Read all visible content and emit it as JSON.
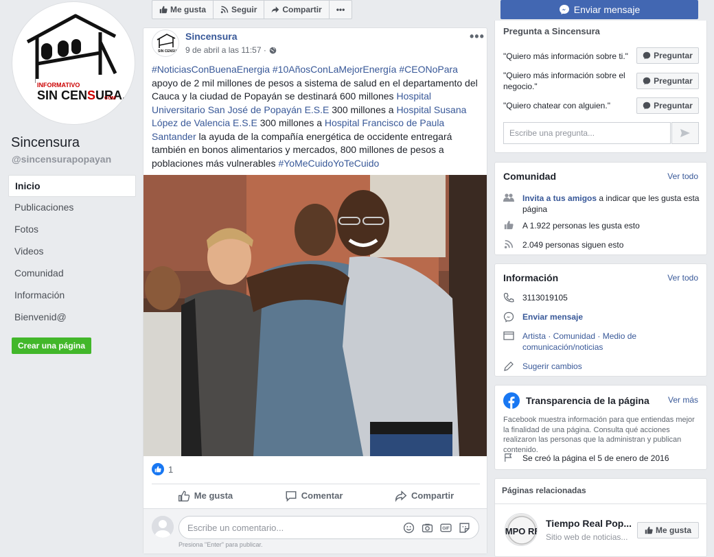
{
  "page": {
    "name": "Sincensura",
    "handle": "@sincensurapopayan",
    "logo_text": "INFORMATIVO SIN CENSURA.COM"
  },
  "nav": [
    {
      "label": "Inicio",
      "active": true
    },
    {
      "label": "Publicaciones"
    },
    {
      "label": "Fotos"
    },
    {
      "label": "Videos"
    },
    {
      "label": "Comunidad"
    },
    {
      "label": "Información"
    },
    {
      "label": "Bienvenid@"
    }
  ],
  "create_page": "Crear una página",
  "actionbar": {
    "like": "Me gusta",
    "follow": "Seguir",
    "share": "Compartir",
    "more": "•••"
  },
  "send_message": "Enviar mensaje",
  "post": {
    "author": "Sincensura",
    "date": "9 de abril a las 11:57 ·",
    "text": [
      {
        "t": "#NoticiasConBuenaEnergia #10AñosConLaMejorEnergía",
        "c": "tag"
      },
      {
        "t": " ",
        "c": ""
      },
      {
        "t": "#CEONoPara",
        "c": "tag"
      },
      {
        "t": " apoyo de 2 mil millones de pesos a sistema de salud en el departamento del Cauca y la ciudad de Popayán se destinará 600 millones ",
        "c": ""
      },
      {
        "t": "Hospital Universitario San José de Popayán E.S.E",
        "c": "lnk"
      },
      {
        "t": " 300 millones a ",
        "c": ""
      },
      {
        "t": "Hospital Susana López de Valencia E.S.E",
        "c": "lnk"
      },
      {
        "t": " 300 millones a ",
        "c": ""
      },
      {
        "t": "Hospital Francisco de Paula Santander",
        "c": "lnk"
      },
      {
        "t": " la ayuda de la compañía energética de occidente entregará también en bonos alimentarios y mercados, 800 millones de pesos a poblaciones más vulnerables ",
        "c": ""
      },
      {
        "t": "#YoMeCuidoYoTeCuido",
        "c": "tag"
      }
    ],
    "reaction_count": "1",
    "actions": {
      "like": "Me gusta",
      "comment": "Comentar",
      "share": "Compartir"
    },
    "comment_placeholder": "Escribe un comentario...",
    "comment_hint": "Presiona \"Enter\" para publicar."
  },
  "ask": {
    "title": "Pregunta a Sincensura",
    "questions": [
      "\"Quiero más información sobre ti.\"",
      "\"Quiero más información sobre el negocio.\"",
      "\"Quiero chatear con alguien.\""
    ],
    "button": "Preguntar",
    "input_placeholder": "Escribe una pregunta..."
  },
  "comunidad": {
    "title": "Comunidad",
    "link": "Ver todo",
    "invite_link": "Invita a tus amigos",
    "invite_rest": " a indicar que les gusta esta página",
    "likes": "A 1.922 personas les gusta esto",
    "follows": "2.049 personas siguen esto"
  },
  "info": {
    "title": "Información",
    "link": "Ver todo",
    "phone": "3113019105",
    "message": "Enviar mensaje",
    "categories": "Artista · Comunidad · Medio de comunicación/noticias",
    "suggest": "Sugerir cambios"
  },
  "transparency": {
    "title": "Transparencia de la página",
    "link": "Ver más",
    "body": "Facebook muestra información para que entiendas mejor la finalidad de una página. Consulta qué acciones realizaron las personas que la administran y publican contenido.",
    "created": "Se creó la página el 5 de enero de 2016"
  },
  "related": {
    "title": "Páginas relacionadas",
    "page_name": "Tiempo Real Pop...",
    "page_desc": "Sitio web de noticias...",
    "logo_text": "TIEMPO REAL",
    "like": "Me gusta"
  },
  "colors": {
    "fb_blue": "#4267b2",
    "link": "#385898",
    "green": "#42b72a",
    "background": "#e9ebee"
  }
}
